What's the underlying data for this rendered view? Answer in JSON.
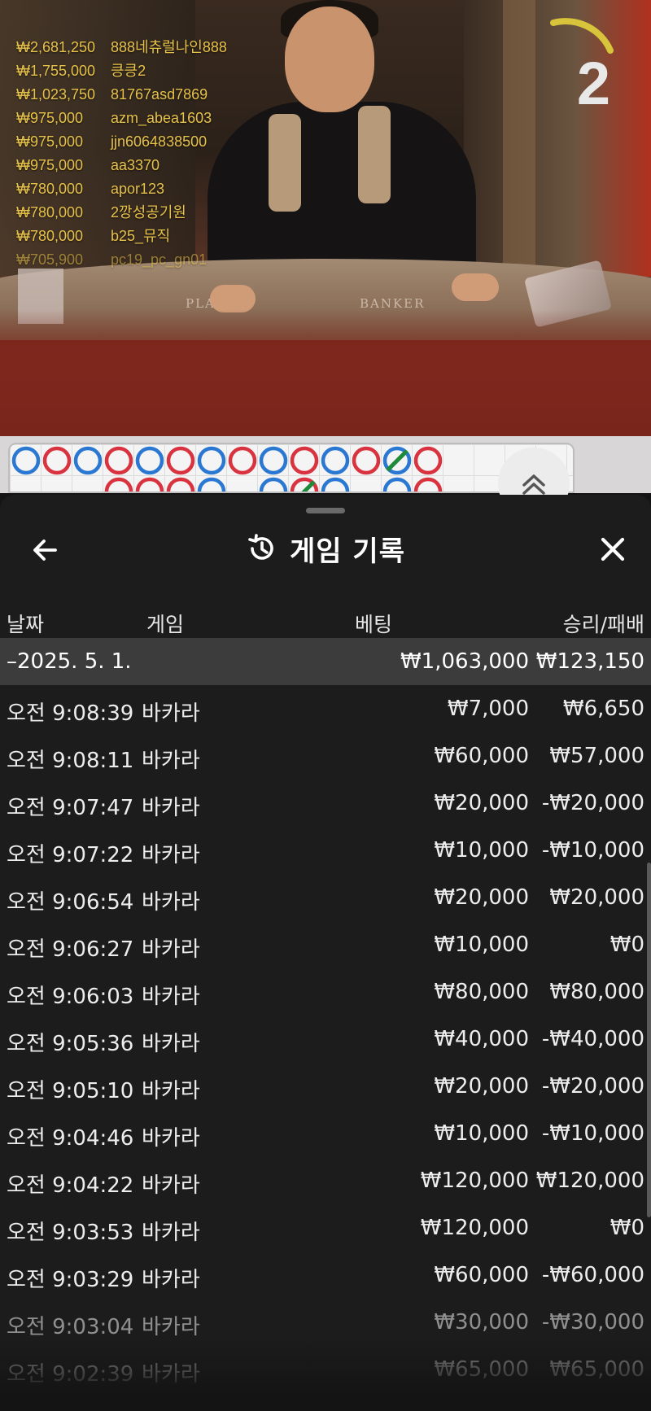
{
  "leaderboard": [
    {
      "amount": "₩2,681,250",
      "user": "888네츄럴나인888"
    },
    {
      "amount": "₩1,755,000",
      "user": "킁킁2"
    },
    {
      "amount": "₩1,023,750",
      "user": "81767asd7869"
    },
    {
      "amount": "₩975,000",
      "user": "azm_abea1603"
    },
    {
      "amount": "₩975,000",
      "user": "jjn6064838500"
    },
    {
      "amount": "₩975,000",
      "user": "aa3370"
    },
    {
      "amount": "₩780,000",
      "user": "apor123"
    },
    {
      "amount": "₩780,000",
      "user": "2깡성공기원"
    },
    {
      "amount": "₩780,000",
      "user": "b25_뮤직"
    },
    {
      "amount": "₩705,900",
      "user": "pc19_pc_gn01"
    }
  ],
  "video": {
    "round_number": "2",
    "table_labels": {
      "player": "PLAYER",
      "banker": "BANKER"
    }
  },
  "roadmap": {
    "side_chip": "4"
  },
  "sheet": {
    "title": "게임 기록",
    "icons": {
      "back": "back-arrow-icon",
      "history": "history-icon",
      "close": "close-icon"
    },
    "columns": {
      "date": "날짜",
      "game": "게임",
      "bet": "베팅",
      "win_loss": "승리/패배"
    },
    "day_summary": {
      "date": "–2025. 5. 1.",
      "bet": "₩1,063,000",
      "win_loss": "₩123,150"
    },
    "rows": [
      {
        "time": "오전 9:08:39",
        "game": "바카라",
        "bet": "₩7,000",
        "win_loss": "₩6,650"
      },
      {
        "time": "오전 9:08:11",
        "game": "바카라",
        "bet": "₩60,000",
        "win_loss": "₩57,000"
      },
      {
        "time": "오전 9:07:47",
        "game": "바카라",
        "bet": "₩20,000",
        "win_loss": "-₩20,000"
      },
      {
        "time": "오전 9:07:22",
        "game": "바카라",
        "bet": "₩10,000",
        "win_loss": "-₩10,000"
      },
      {
        "time": "오전 9:06:54",
        "game": "바카라",
        "bet": "₩20,000",
        "win_loss": "₩20,000"
      },
      {
        "time": "오전 9:06:27",
        "game": "바카라",
        "bet": "₩10,000",
        "win_loss": "₩0"
      },
      {
        "time": "오전 9:06:03",
        "game": "바카라",
        "bet": "₩80,000",
        "win_loss": "₩80,000"
      },
      {
        "time": "오전 9:05:36",
        "game": "바카라",
        "bet": "₩40,000",
        "win_loss": "-₩40,000"
      },
      {
        "time": "오전 9:05:10",
        "game": "바카라",
        "bet": "₩20,000",
        "win_loss": "-₩20,000"
      },
      {
        "time": "오전 9:04:46",
        "game": "바카라",
        "bet": "₩10,000",
        "win_loss": "-₩10,000"
      },
      {
        "time": "오전 9:04:22",
        "game": "바카라",
        "bet": "₩120,000",
        "win_loss": "₩120,000"
      },
      {
        "time": "오전 9:03:53",
        "game": "바카라",
        "bet": "₩120,000",
        "win_loss": "₩0"
      },
      {
        "time": "오전 9:03:29",
        "game": "바카라",
        "bet": "₩60,000",
        "win_loss": "-₩60,000"
      },
      {
        "time": "오전 9:03:04",
        "game": "바카라",
        "bet": "₩30,000",
        "win_loss": "-₩30,000"
      },
      {
        "time": "오전 9:02:39",
        "game": "바카라",
        "bet": "₩65,000",
        "win_loss": "₩65,000"
      }
    ]
  },
  "colors": {
    "leaderboard_text": "#e7c24a",
    "sheet_bg": "#1c1c1c",
    "day_row_bg": "#3c3c3c",
    "banker_bead": "#d9333f",
    "player_bead": "#2a78d2",
    "tie_mark": "#1f8a3a"
  }
}
